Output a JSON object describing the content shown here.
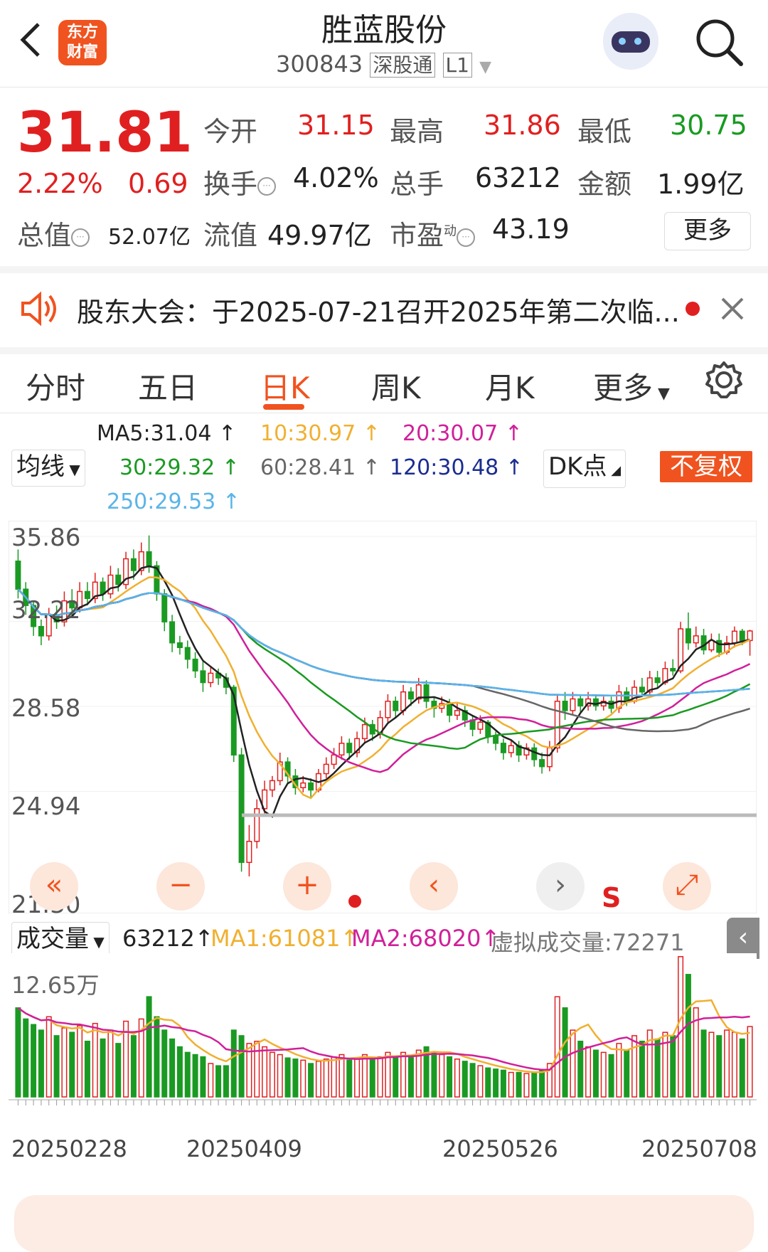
{
  "header": {
    "back_icon": "chevron-left-icon",
    "logo_line1": "东方",
    "logo_line2": "财富",
    "stock_name": "胜蓝股份",
    "stock_code": "300843",
    "market_tag": "深股通",
    "level_tag": "L1",
    "search_icon": "search-icon"
  },
  "quote": {
    "price": "31.81",
    "change_pct": "2.22%",
    "change_amt": "0.69",
    "open_label": "今开",
    "open": "31.15",
    "high_label": "最高",
    "high": "31.86",
    "low_label": "最低",
    "low": "30.75",
    "turnover_label": "换手",
    "turnover": "4.02%",
    "volume_label": "总手",
    "volume": "63212",
    "amount_label": "金额",
    "amount": "1.99亿",
    "mktcap_label": "总值",
    "mktcap": "52.07亿",
    "float_label": "流值",
    "float_cap": "49.97亿",
    "pe_label": "市盈",
    "pe_sup": "动",
    "pe": "43.19",
    "more_label": "更多"
  },
  "notice": {
    "text": "股东大会：于2025-07-21召开2025年第二次临...",
    "speaker_icon": "speaker-icon",
    "close_icon": "close-icon"
  },
  "tabs": [
    "分时",
    "五日",
    "日K",
    "周K",
    "月K",
    "更多"
  ],
  "active_tab": "日K",
  "settings_icon": "gear-icon",
  "ma": {
    "selector": "均线",
    "ma5": "MA5:31.04",
    "ma10": "10:30.97",
    "ma20": "20:30.07",
    "ma30": "30:29.32",
    "ma60": "60:28.41",
    "ma120": "120:30.48",
    "ma250": "250:29.53",
    "dk_label": "DK点",
    "adjust_label": "不复权"
  },
  "price_axis": [
    "35.86",
    "32.22",
    "28.58",
    "24.94",
    "21.30"
  ],
  "signal_label": "S",
  "volume": {
    "selector": "成交量",
    "value": "63212",
    "ma1": "MA1:61081",
    "ma2": "MA2:68020",
    "virtual": "虚拟成交量:72271",
    "axis_max": "12.65万"
  },
  "dates": [
    "20250228",
    "20250409",
    "20250526",
    "20250708"
  ],
  "colors": {
    "up": "#e02020",
    "down": "#1a9a22",
    "ma5": "#222222",
    "ma10": "#f0b030",
    "ma20": "#d0209a",
    "ma30": "#1a9a22",
    "ma60": "#666666",
    "ma120": "#1a2d8f",
    "ma250": "#5ab4e8",
    "accent": "#f0531f"
  },
  "chart_data": {
    "type": "candlestick",
    "ylim": [
      21.3,
      35.86
    ],
    "volume_max": 126500,
    "candles": [
      [
        34.8,
        33.6,
        35.3,
        33.2,
        80000
      ],
      [
        33.6,
        32.9,
        33.9,
        32.5,
        70000
      ],
      [
        32.9,
        32.0,
        33.1,
        31.6,
        65000
      ],
      [
        32.0,
        31.6,
        32.3,
        31.2,
        60000
      ],
      [
        31.6,
        32.5,
        32.8,
        31.4,
        72000
      ],
      [
        32.5,
        32.2,
        32.9,
        31.9,
        55000
      ],
      [
        32.2,
        33.1,
        33.5,
        32.0,
        62000
      ],
      [
        33.1,
        32.8,
        33.6,
        32.4,
        58000
      ],
      [
        32.8,
        33.5,
        33.9,
        32.6,
        64000
      ],
      [
        33.5,
        33.2,
        33.9,
        32.9,
        50000
      ],
      [
        33.2,
        33.9,
        34.3,
        33.0,
        66000
      ],
      [
        33.9,
        33.4,
        34.1,
        33.1,
        52000
      ],
      [
        33.4,
        34.2,
        34.6,
        33.2,
        60000
      ],
      [
        34.2,
        33.8,
        34.5,
        33.5,
        48000
      ],
      [
        33.8,
        34.9,
        35.2,
        33.6,
        68000
      ],
      [
        34.9,
        34.4,
        35.3,
        34.0,
        55000
      ],
      [
        34.4,
        35.2,
        35.6,
        34.2,
        70000
      ],
      [
        35.2,
        34.6,
        35.9,
        34.3,
        90000
      ],
      [
        34.6,
        33.4,
        34.8,
        33.1,
        72000
      ],
      [
        33.4,
        32.2,
        33.6,
        31.8,
        60000
      ],
      [
        32.2,
        31.3,
        32.5,
        30.9,
        52000
      ],
      [
        31.3,
        31.1,
        31.6,
        30.8,
        45000
      ],
      [
        31.1,
        30.6,
        31.4,
        30.2,
        40000
      ],
      [
        30.6,
        30.1,
        30.9,
        29.8,
        38000
      ],
      [
        30.1,
        29.6,
        30.5,
        29.2,
        36000
      ],
      [
        29.6,
        30.0,
        30.3,
        29.4,
        30000
      ],
      [
        30.0,
        29.8,
        30.2,
        29.5,
        28000
      ],
      [
        29.8,
        29.4,
        30.0,
        29.1,
        28000
      ],
      [
        29.4,
        26.5,
        29.5,
        26.2,
        60000
      ],
      [
        26.5,
        21.9,
        26.8,
        21.5,
        55000
      ],
      [
        21.9,
        22.8,
        23.5,
        21.3,
        48000
      ],
      [
        22.8,
        24.2,
        24.6,
        22.5,
        50000
      ],
      [
        24.2,
        25.0,
        25.4,
        23.9,
        45000
      ],
      [
        25.0,
        25.4,
        25.6,
        24.7,
        40000
      ],
      [
        25.4,
        26.2,
        26.6,
        25.2,
        38000
      ],
      [
        26.2,
        25.6,
        26.4,
        25.3,
        35000
      ],
      [
        25.6,
        25.1,
        25.9,
        24.8,
        34000
      ],
      [
        25.1,
        25.3,
        25.6,
        24.9,
        33000
      ],
      [
        25.3,
        25.0,
        25.5,
        24.7,
        30000
      ],
      [
        25.0,
        25.7,
        25.9,
        24.9,
        32000
      ],
      [
        25.7,
        26.1,
        26.4,
        25.5,
        34000
      ],
      [
        26.1,
        26.5,
        26.8,
        25.9,
        36000
      ],
      [
        26.5,
        27.0,
        27.3,
        26.3,
        38000
      ],
      [
        27.0,
        26.6,
        27.2,
        26.3,
        33000
      ],
      [
        26.6,
        27.2,
        27.5,
        26.4,
        35000
      ],
      [
        27.2,
        27.8,
        28.1,
        27.0,
        38000
      ],
      [
        27.8,
        27.4,
        28.0,
        27.1,
        34000
      ],
      [
        27.4,
        28.1,
        28.4,
        27.2,
        36000
      ],
      [
        28.1,
        28.8,
        29.1,
        27.9,
        40000
      ],
      [
        28.8,
        28.4,
        29.0,
        28.1,
        35000
      ],
      [
        28.4,
        29.2,
        29.5,
        28.2,
        40000
      ],
      [
        29.2,
        28.9,
        29.4,
        28.6,
        36000
      ],
      [
        28.9,
        29.5,
        29.8,
        28.7,
        42000
      ],
      [
        29.5,
        28.8,
        29.7,
        28.5,
        45000
      ],
      [
        28.8,
        28.5,
        29.0,
        28.1,
        40000
      ],
      [
        28.5,
        28.7,
        29.0,
        28.3,
        38000
      ],
      [
        28.7,
        28.2,
        28.9,
        27.9,
        36000
      ],
      [
        28.2,
        28.4,
        28.7,
        28.0,
        34000
      ],
      [
        28.4,
        28.0,
        28.6,
        27.7,
        32000
      ],
      [
        28.0,
        27.6,
        28.2,
        27.3,
        30000
      ],
      [
        27.6,
        27.9,
        28.2,
        27.4,
        28000
      ],
      [
        27.9,
        27.3,
        28.0,
        27.0,
        26000
      ],
      [
        27.3,
        27.0,
        27.5,
        26.7,
        25000
      ],
      [
        27.0,
        26.6,
        27.2,
        26.3,
        24000
      ],
      [
        26.6,
        26.9,
        27.1,
        26.4,
        22000
      ],
      [
        26.9,
        26.5,
        27.1,
        26.2,
        22000
      ],
      [
        26.5,
        26.8,
        27.0,
        26.3,
        21000
      ],
      [
        26.8,
        26.3,
        27.0,
        26.0,
        22000
      ],
      [
        26.3,
        26.0,
        26.6,
        25.7,
        24000
      ],
      [
        26.0,
        26.8,
        27.1,
        25.8,
        30000
      ],
      [
        26.8,
        28.8,
        29.1,
        26.6,
        90000
      ],
      [
        28.8,
        28.4,
        29.2,
        28.0,
        80000
      ],
      [
        28.4,
        28.9,
        29.2,
        28.2,
        60000
      ],
      [
        28.9,
        28.6,
        29.1,
        28.3,
        50000
      ],
      [
        28.6,
        28.9,
        29.2,
        28.4,
        45000
      ],
      [
        28.9,
        28.6,
        29.1,
        28.4,
        42000
      ],
      [
        28.6,
        28.8,
        29.0,
        28.4,
        40000
      ],
      [
        28.8,
        28.5,
        29.0,
        28.3,
        38000
      ],
      [
        28.5,
        29.2,
        29.5,
        28.3,
        48000
      ],
      [
        29.2,
        28.8,
        29.4,
        28.6,
        42000
      ],
      [
        28.8,
        29.4,
        29.7,
        28.7,
        55000
      ],
      [
        29.4,
        29.2,
        29.8,
        29.0,
        50000
      ],
      [
        29.2,
        29.8,
        30.1,
        29.1,
        60000
      ],
      [
        29.8,
        29.6,
        30.1,
        29.4,
        52000
      ],
      [
        29.6,
        30.2,
        30.5,
        29.5,
        58000
      ],
      [
        30.2,
        30.1,
        30.6,
        29.9,
        55000
      ],
      [
        30.1,
        31.9,
        32.2,
        30.0,
        126000
      ],
      [
        31.9,
        31.3,
        32.6,
        31.0,
        110000
      ],
      [
        31.3,
        31.6,
        32.0,
        31.1,
        80000
      ],
      [
        31.6,
        31.0,
        31.9,
        30.8,
        60000
      ],
      [
        31.0,
        31.4,
        31.7,
        30.9,
        58000
      ],
      [
        31.4,
        30.9,
        31.7,
        30.7,
        55000
      ],
      [
        30.9,
        31.3,
        31.6,
        30.8,
        60000
      ],
      [
        31.3,
        31.8,
        32.0,
        31.1,
        58000
      ],
      [
        31.8,
        31.4,
        31.9,
        31.2,
        52000
      ],
      [
        31.4,
        31.81,
        31.86,
        30.75,
        63212
      ]
    ]
  }
}
